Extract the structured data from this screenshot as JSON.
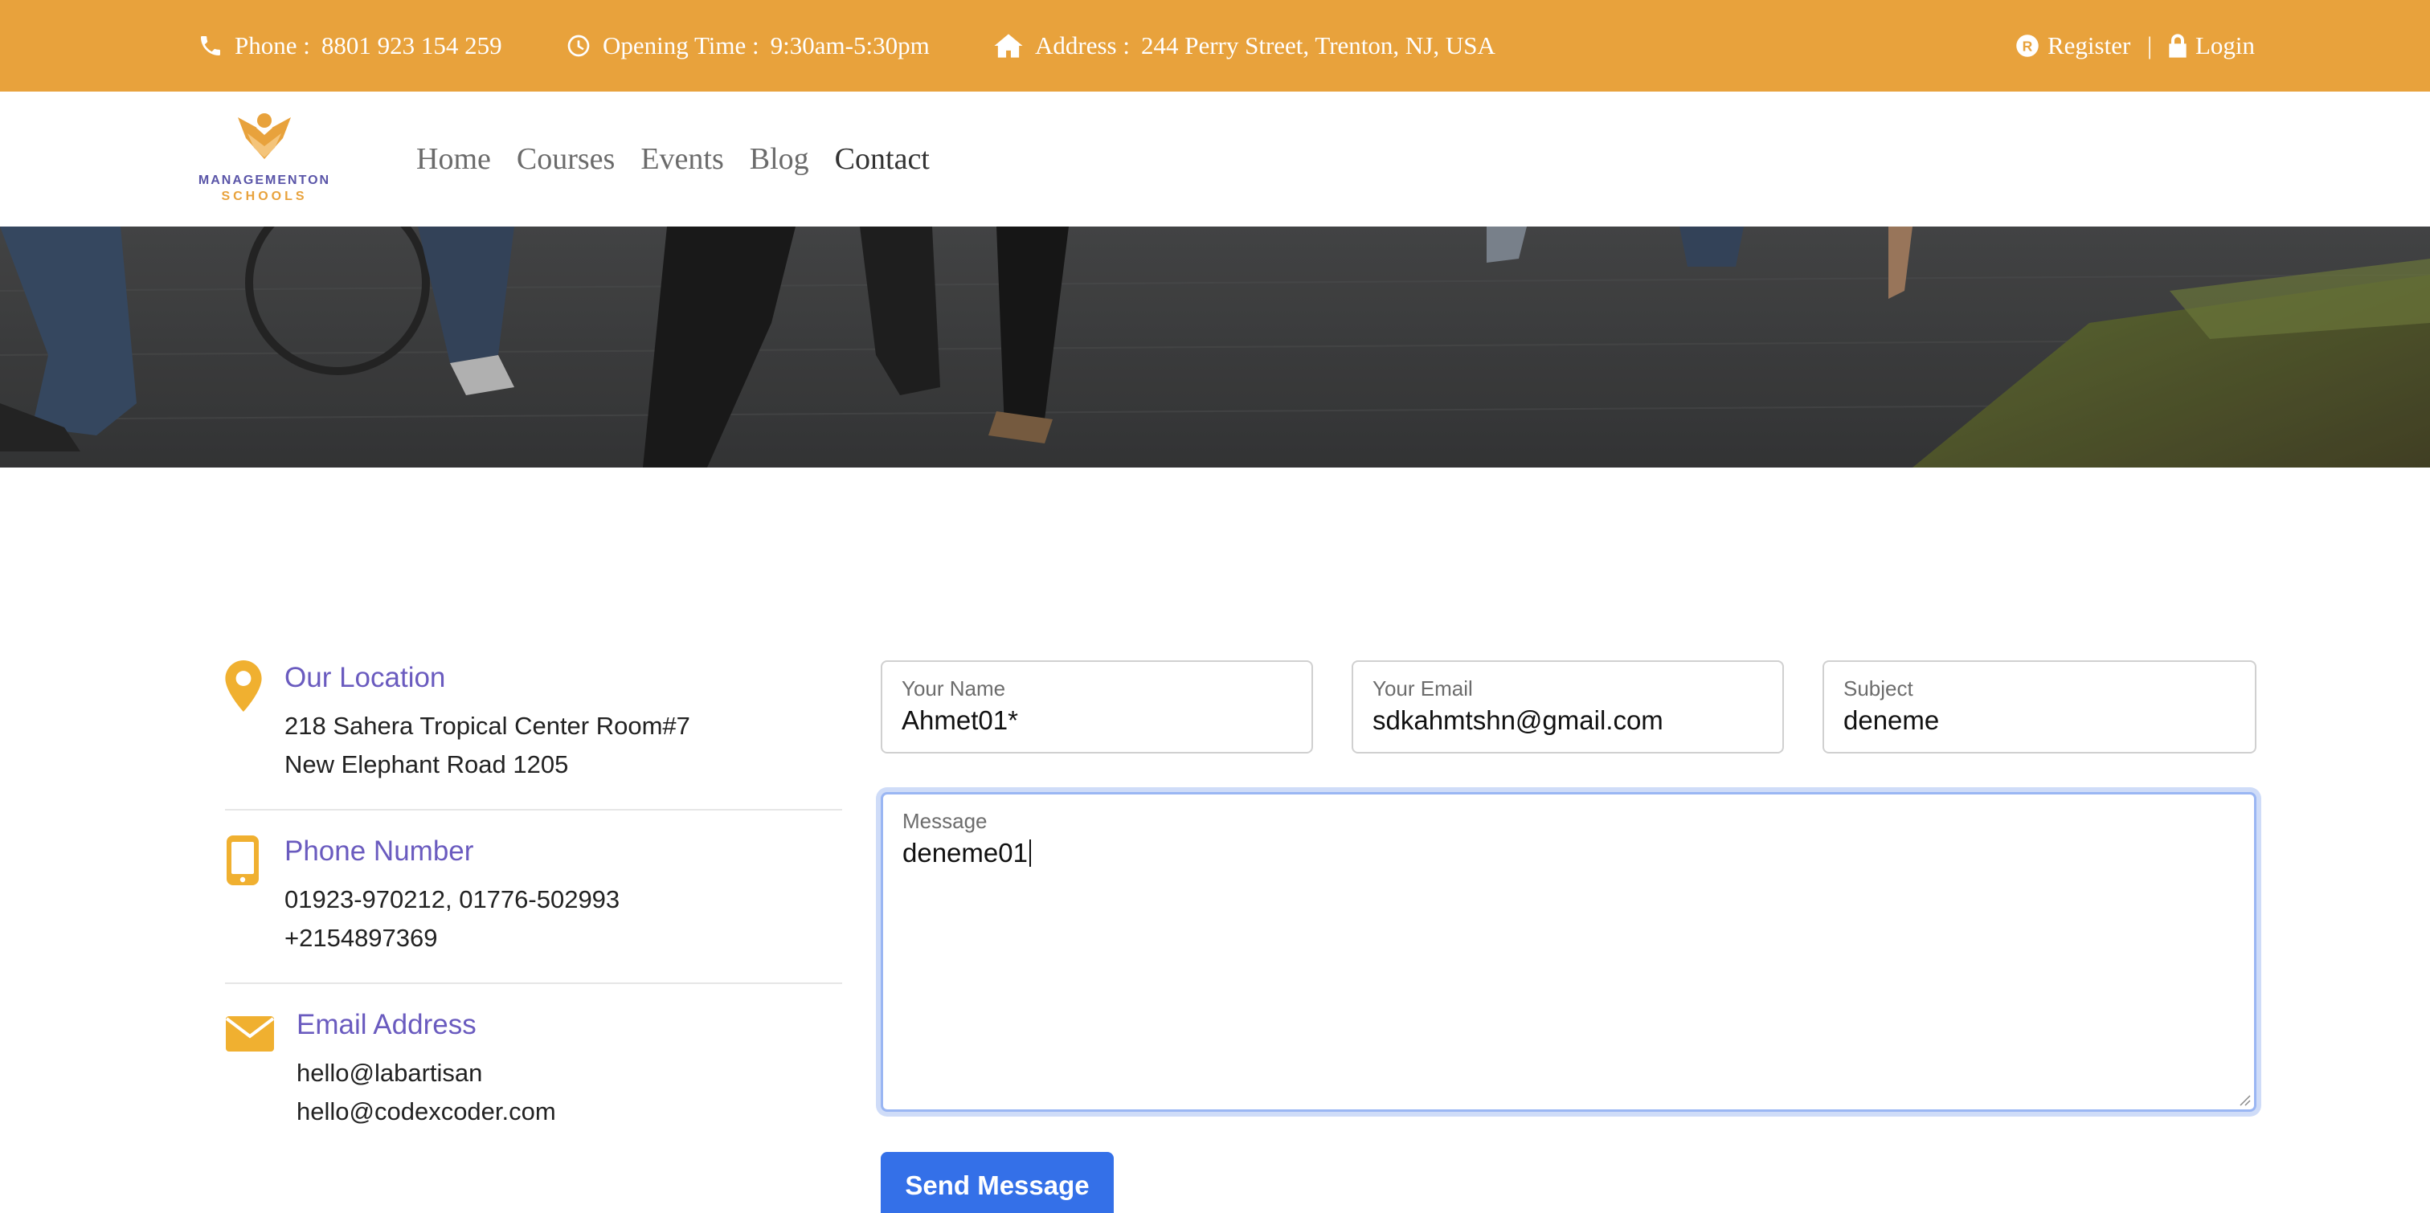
{
  "topbar": {
    "phone_label": "Phone :",
    "phone_value": "8801 923 154 259",
    "hours_label": "Opening Time :",
    "hours_value": "9:30am-5:30pm",
    "address_label": "Address :",
    "address_value": "244 Perry Street, Trenton, NJ, USA",
    "register": "Register",
    "separator": "|",
    "login": "Login"
  },
  "brand": {
    "line1": "MANAGEMENTON",
    "line2": "SCHOOLS",
    "color_primary": "#5a55a8",
    "color_accent": "#e8a23c"
  },
  "nav": {
    "items": [
      "Home",
      "Courses",
      "Events",
      "Blog",
      "Contact"
    ],
    "active": "Contact"
  },
  "contact_info": {
    "location": {
      "title": "Our Location",
      "line1": "218 Sahera Tropical Center Room#7",
      "line2": "New Elephant Road 1205",
      "icon": "map-pin-icon"
    },
    "phone": {
      "title": "Phone Number",
      "line1": "01923-970212, 01776-502993",
      "line2": "+2154897369",
      "icon": "mobile-phone-icon"
    },
    "email": {
      "title": "Email Address",
      "line1": "hello@labartisan",
      "line2": "hello@codexcoder.com",
      "icon": "envelope-icon"
    }
  },
  "form": {
    "name": {
      "label": "Your Name",
      "value": "Ahmet01*"
    },
    "email": {
      "label": "Your Email",
      "value": "sdkahmtshn@gmail.com"
    },
    "subject": {
      "label": "Subject",
      "value": "deneme"
    },
    "message": {
      "label": "Message",
      "value": "deneme01"
    },
    "submit_label": "Send Message"
  },
  "colors": {
    "topbar_bg": "#e8a23c",
    "title_purple": "#6a5bbf",
    "icon_orange": "#f0b030",
    "button_blue": "#3470e8"
  }
}
